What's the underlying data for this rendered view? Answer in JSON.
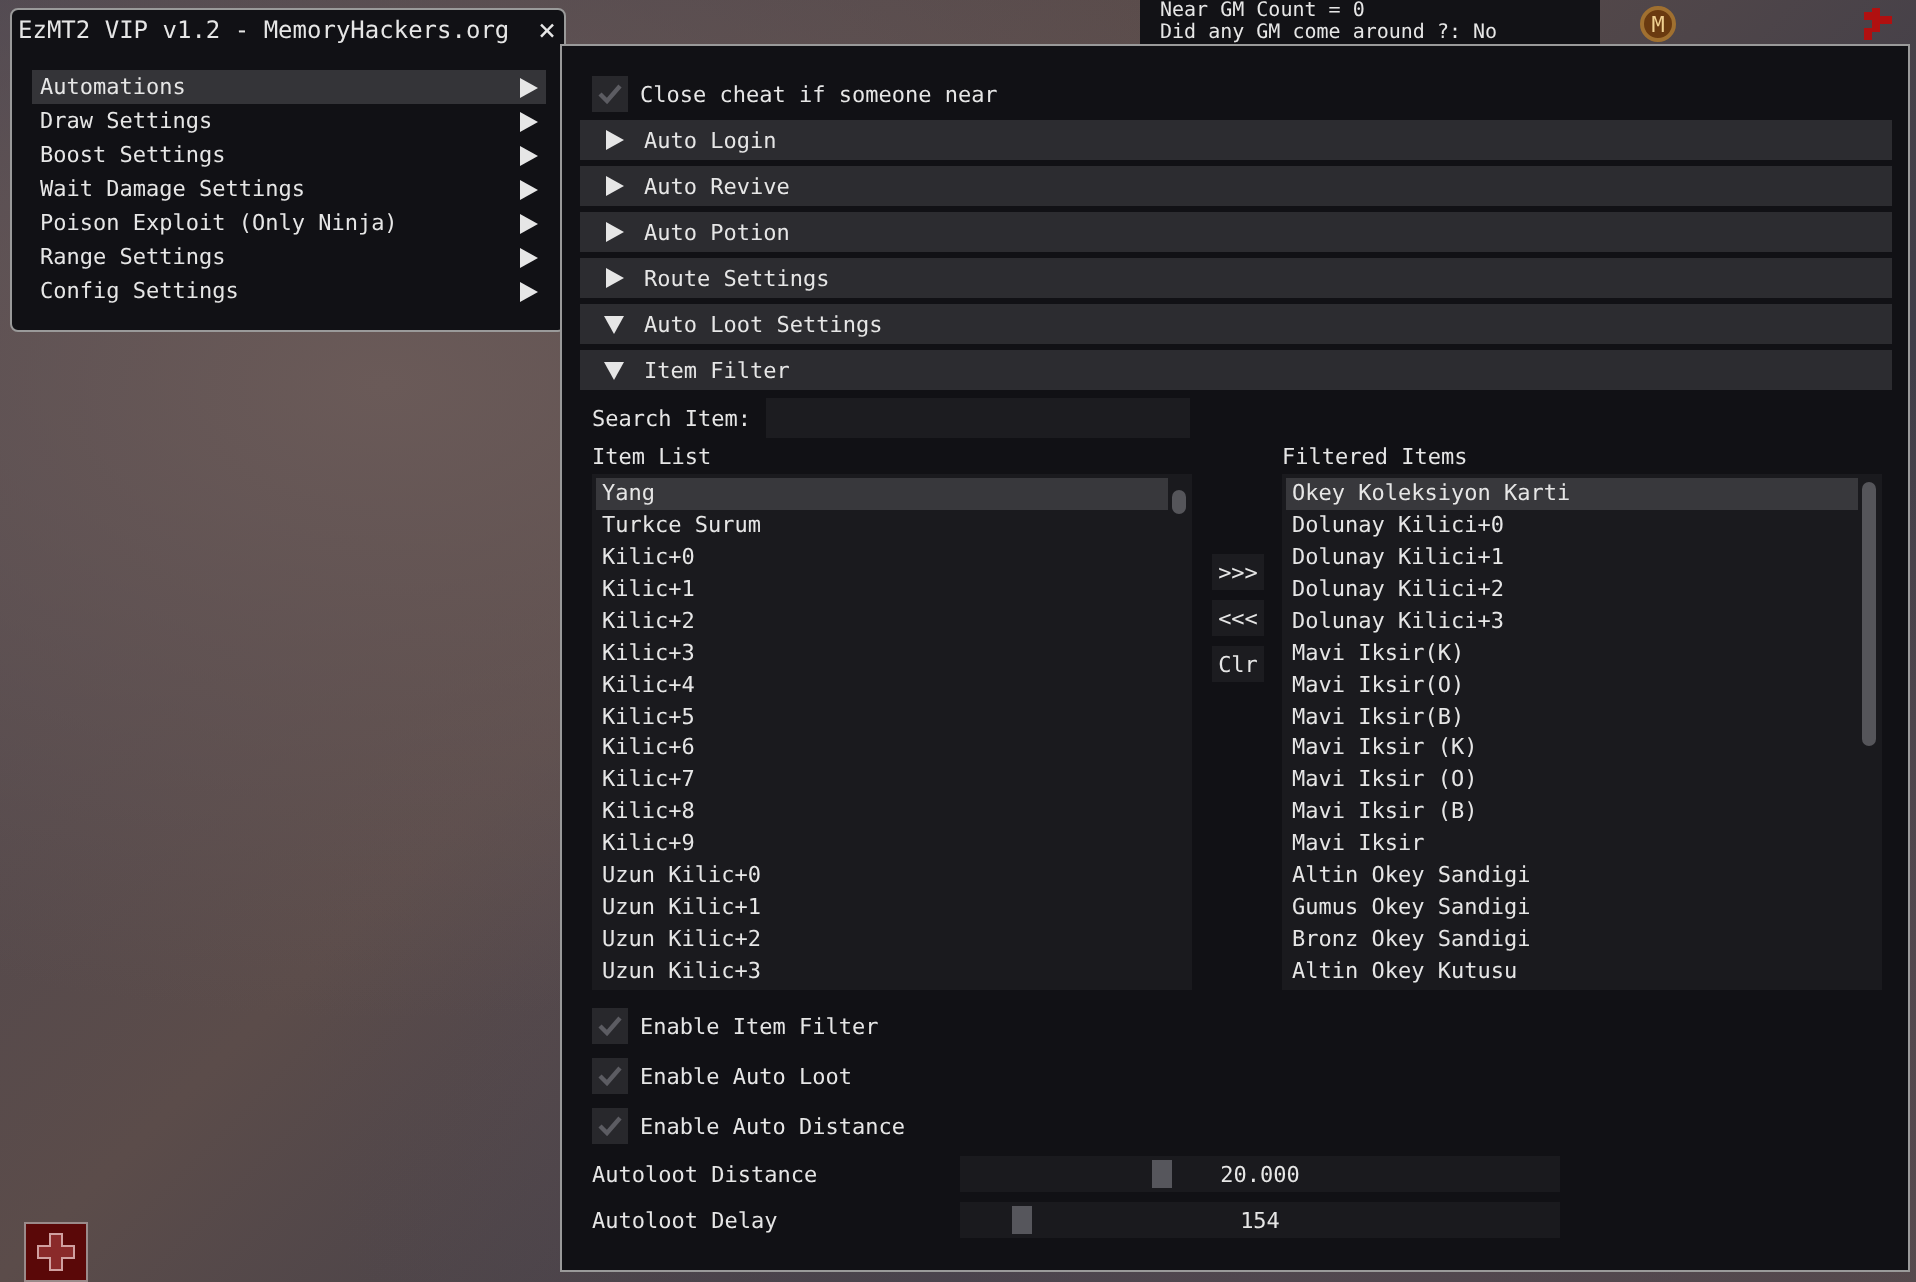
{
  "gm_panel": {
    "lines": [
      "Near GM Count = 0",
      "Did any GM come around ?: No"
    ]
  },
  "map_badge": "M",
  "menu_window": {
    "title": "EzMT2 VIP v1.2 - MemoryHackers.org",
    "close": "×",
    "items": [
      {
        "label": "Automations",
        "selected": true
      },
      {
        "label": "Draw Settings",
        "selected": false
      },
      {
        "label": "Boost Settings",
        "selected": false
      },
      {
        "label": "Wait Damage Settings",
        "selected": false
      },
      {
        "label": "Poison Exploit (Only Ninja)",
        "selected": false
      },
      {
        "label": "Range Settings",
        "selected": false
      },
      {
        "label": "Config Settings",
        "selected": false
      }
    ]
  },
  "main_window": {
    "close_cheat": {
      "label": "Close cheat if someone near",
      "checked": true
    },
    "sections": [
      {
        "label": "Auto Login",
        "expanded": false
      },
      {
        "label": "Auto Revive",
        "expanded": false
      },
      {
        "label": "Auto Potion",
        "expanded": false
      },
      {
        "label": "Route Settings",
        "expanded": false
      },
      {
        "label": "Auto Loot Settings",
        "expanded": true
      },
      {
        "label": "Item Filter",
        "expanded": true
      }
    ],
    "item_filter": {
      "search_label": "Search Item:",
      "item_list": {
        "title": "Item List",
        "items": [
          {
            "label": "Yang",
            "selected": true
          },
          {
            "label": "Turkce Surum",
            "selected": false
          },
          {
            "label": "Kilic+0",
            "selected": false
          },
          {
            "label": "Kilic+1",
            "selected": false
          },
          {
            "label": "Kilic+2",
            "selected": false
          },
          {
            "label": "Kilic+3",
            "selected": false
          },
          {
            "label": "Kilic+4",
            "selected": false
          },
          {
            "label": "Kilic+5",
            "selected": false
          },
          {
            "label": "Kilic+6",
            "selected": false
          },
          {
            "label": "Kilic+7",
            "selected": false
          },
          {
            "label": "Kilic+8",
            "selected": false
          },
          {
            "label": "Kilic+9",
            "selected": false
          },
          {
            "label": "Uzun Kilic+0",
            "selected": false
          },
          {
            "label": "Uzun Kilic+1",
            "selected": false
          },
          {
            "label": "Uzun Kilic+2",
            "selected": false
          },
          {
            "label": "Uzun Kilic+3",
            "selected": false
          }
        ]
      },
      "transfer_buttons": [
        ">>>",
        "<<<",
        "Clr"
      ],
      "filtered_items": {
        "title": "Filtered Items",
        "items": [
          {
            "label": "Okey Koleksiyon Karti",
            "selected": true
          },
          {
            "label": "Dolunay Kilici+0",
            "selected": false
          },
          {
            "label": "Dolunay Kilici+1",
            "selected": false
          },
          {
            "label": "Dolunay Kilici+2",
            "selected": false
          },
          {
            "label": "Dolunay Kilici+3",
            "selected": false
          },
          {
            "label": "Mavi Iksir(K)",
            "selected": false
          },
          {
            "label": "Mavi Iksir(O)",
            "selected": false
          },
          {
            "label": "Mavi Iksir(B)",
            "selected": false
          },
          {
            "label": "Mavi Iksir (K)",
            "selected": false
          },
          {
            "label": "Mavi Iksir (O)",
            "selected": false
          },
          {
            "label": "Mavi Iksir (B)",
            "selected": false
          },
          {
            "label": "Mavi Iksir",
            "selected": false
          },
          {
            "label": "Altin Okey Sandigi",
            "selected": false
          },
          {
            "label": "Gumus Okey Sandigi",
            "selected": false
          },
          {
            "label": "Bronz Okey Sandigi",
            "selected": false
          },
          {
            "label": "Altin Okey Kutusu",
            "selected": false
          }
        ]
      }
    },
    "checkboxes": [
      {
        "label": "Enable Item Filter",
        "checked": true
      },
      {
        "label": "Enable Auto Loot",
        "checked": true
      },
      {
        "label": "Enable Auto Distance",
        "checked": true
      }
    ],
    "sliders": [
      {
        "label": "Autoloot Distance",
        "level": 0.33,
        "reading": "20.000"
      },
      {
        "label": "Autoloot Delay",
        "level": 0.09,
        "reading": "154"
      }
    ]
  }
}
